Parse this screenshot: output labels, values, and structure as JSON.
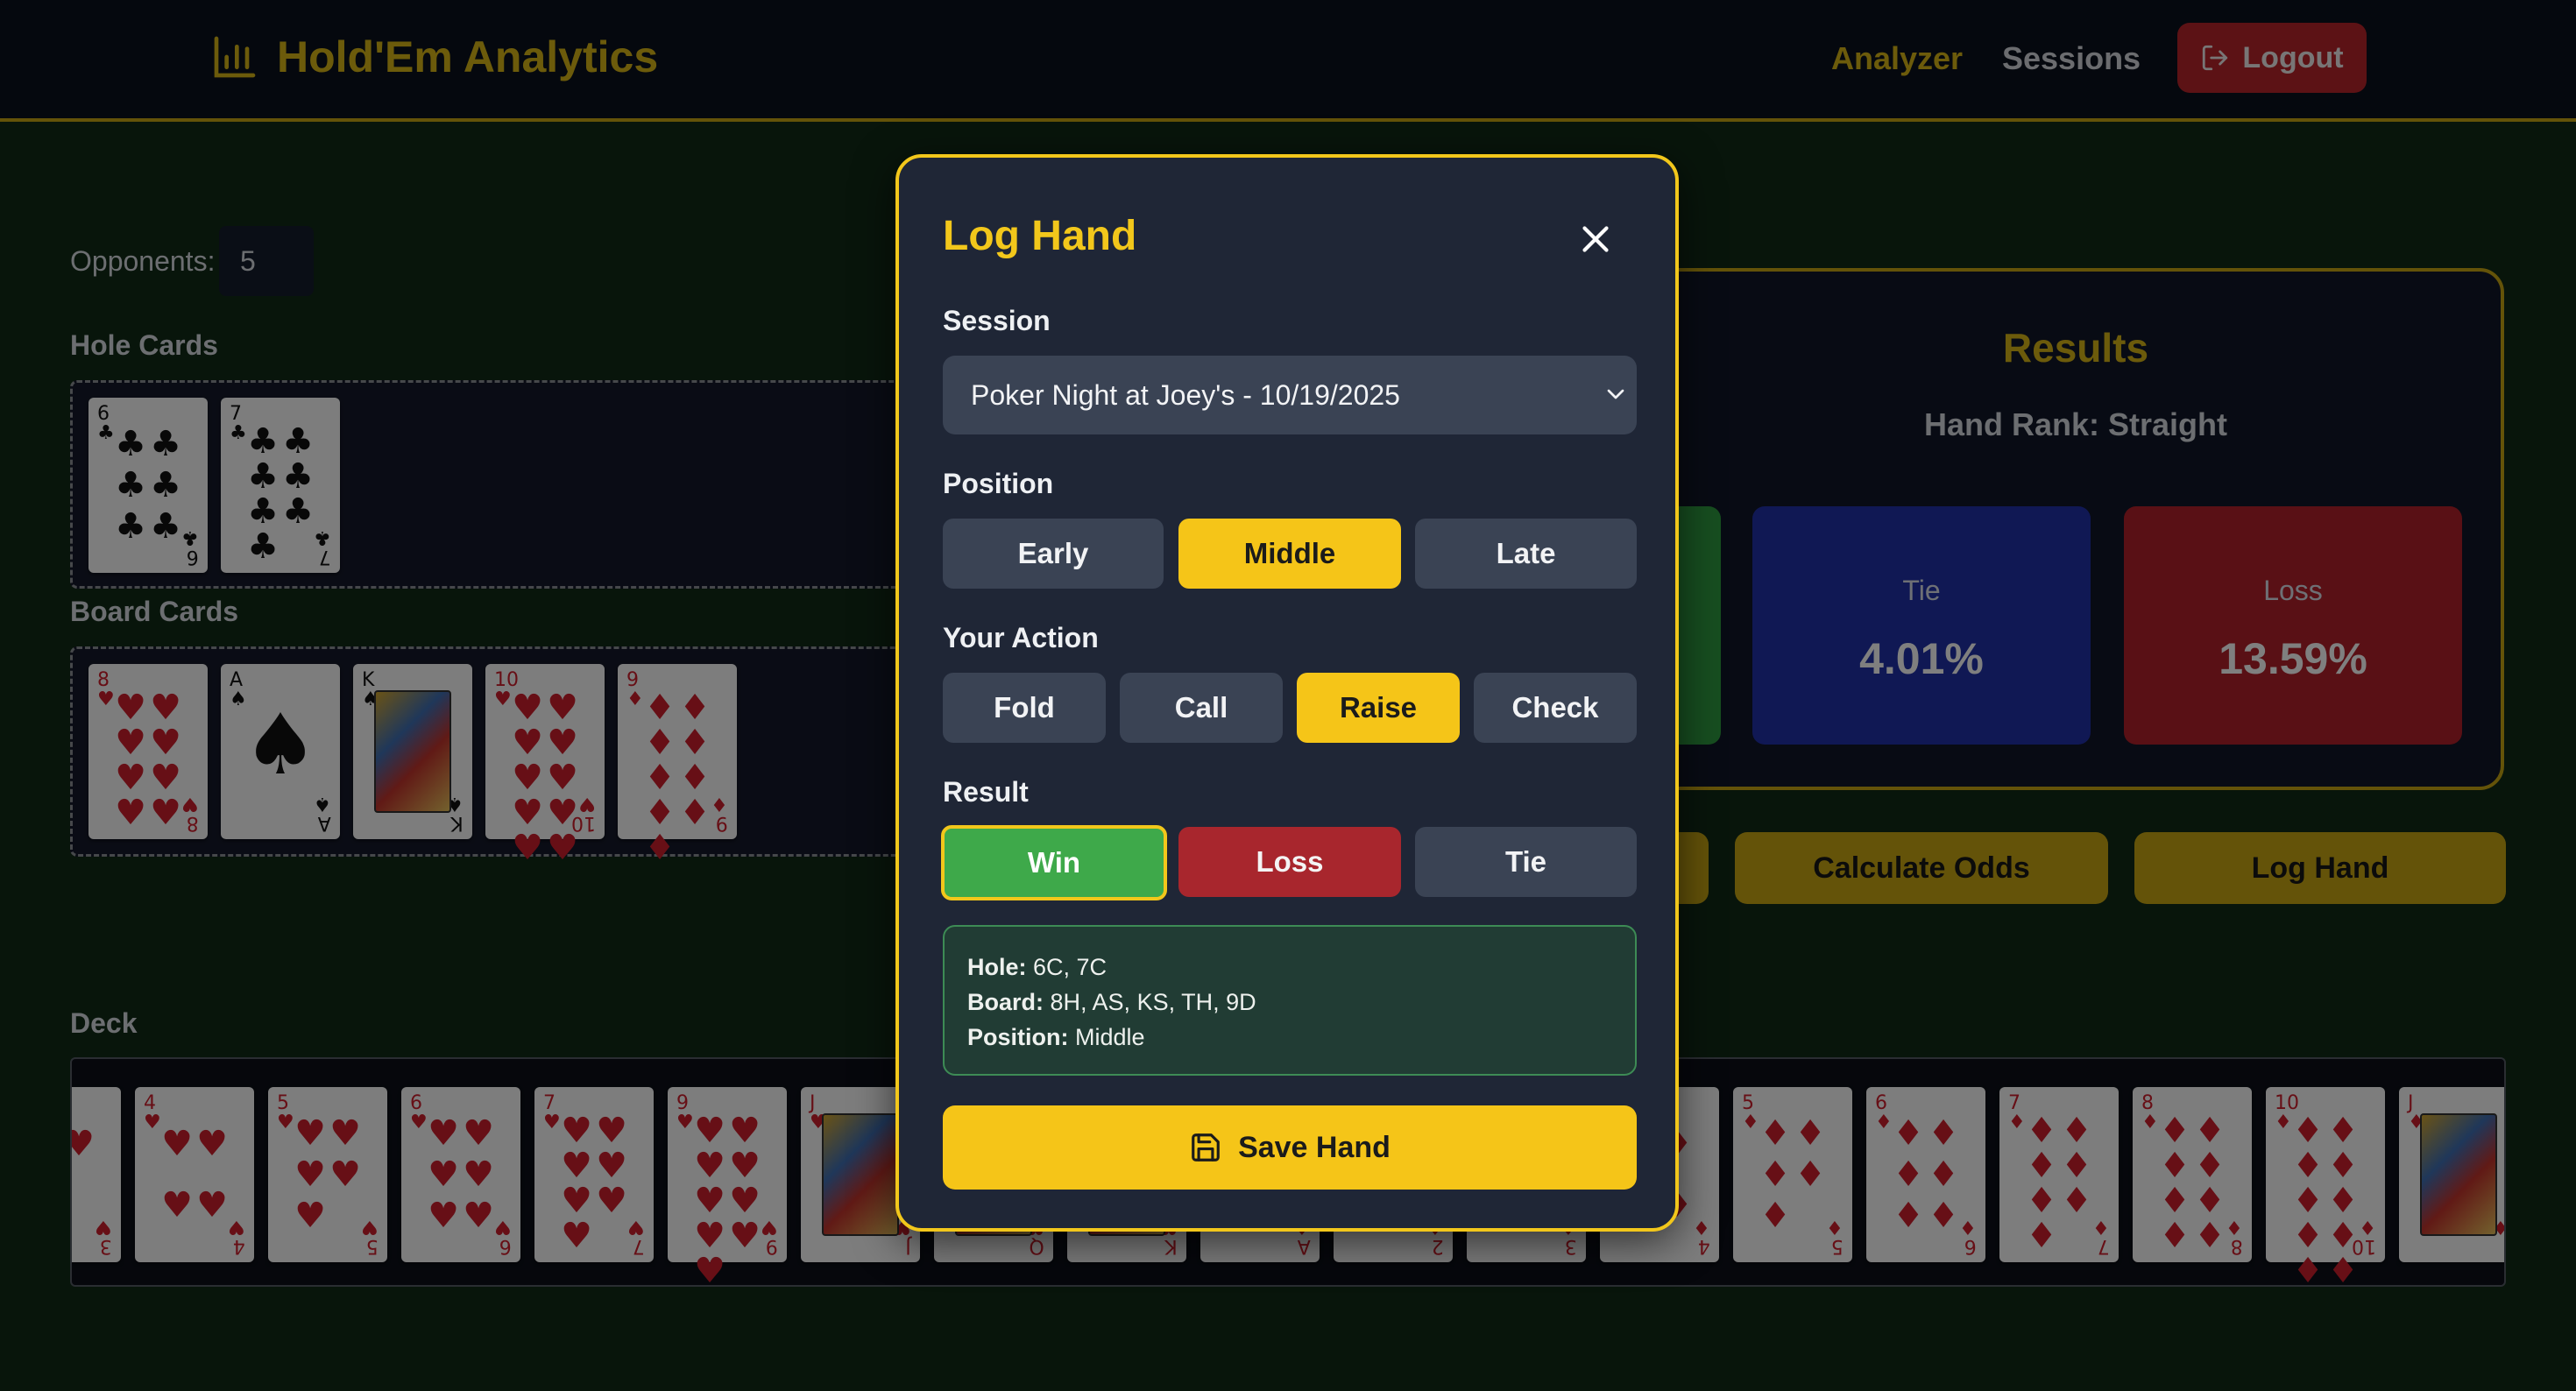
{
  "nav": {
    "brand": "Hold'Em Analytics",
    "brand_icon": "bar-chart-icon",
    "links": [
      "Analyzer",
      "Sessions"
    ],
    "logout": "Logout",
    "colors": {
      "accent": "#d8b616",
      "logout": "#b8242a"
    }
  },
  "analyzer": {
    "opponents_label": "Opponents:",
    "opponents_value": "5",
    "hole_label": "Hole Cards",
    "board_label": "Board Cards",
    "deck_label": "Deck",
    "hole_cards": [
      {
        "rank": "6",
        "suit": "♣"
      },
      {
        "rank": "7",
        "suit": "♣"
      }
    ],
    "board_cards": [
      {
        "rank": "8",
        "suit": "♥"
      },
      {
        "rank": "A",
        "suit": "♠"
      },
      {
        "rank": "K",
        "suit": "♠"
      },
      {
        "rank": "10",
        "suit": "♥"
      },
      {
        "rank": "9",
        "suit": "♦"
      }
    ],
    "deck_cards": [
      {
        "rank": "3",
        "suit": "♥"
      },
      {
        "rank": "4",
        "suit": "♥"
      },
      {
        "rank": "5",
        "suit": "♥"
      },
      {
        "rank": "6",
        "suit": "♥"
      },
      {
        "rank": "7",
        "suit": "♥"
      },
      {
        "rank": "9",
        "suit": "♥"
      },
      {
        "rank": "J",
        "suit": "♥"
      },
      {
        "rank": "Q",
        "suit": "♥"
      },
      {
        "rank": "K",
        "suit": "♥"
      },
      {
        "rank": "A",
        "suit": "♦"
      },
      {
        "rank": "2",
        "suit": "♦"
      },
      {
        "rank": "3",
        "suit": "♦"
      },
      {
        "rank": "4",
        "suit": "♦"
      },
      {
        "rank": "5",
        "suit": "♦"
      },
      {
        "rank": "6",
        "suit": "♦"
      },
      {
        "rank": "7",
        "suit": "♦"
      },
      {
        "rank": "8",
        "suit": "♦"
      },
      {
        "rank": "10",
        "suit": "♦"
      },
      {
        "rank": "J",
        "suit": "♦"
      }
    ]
  },
  "results": {
    "title": "Results",
    "hand_rank": "Hand Rank: Straight",
    "tie_label": "Tie",
    "tie_value": "4.01%",
    "loss_label": "Loss",
    "loss_value": "13.59%",
    "calculate_btn": "Calculate Odds",
    "log_btn": "Log Hand"
  },
  "modal": {
    "title": "Log Hand",
    "session_label": "Session",
    "session_value": "Poker Night at Joey's - 10/19/2025",
    "position_label": "Position",
    "positions": [
      "Early",
      "Middle",
      "Late"
    ],
    "position_selected": "Middle",
    "action_label": "Your Action",
    "actions": [
      "Fold",
      "Call",
      "Raise",
      "Check"
    ],
    "action_selected": "Raise",
    "result_label": "Result",
    "results": [
      "Win",
      "Loss",
      "Tie"
    ],
    "result_selected": "Win",
    "summary": {
      "hole_label": "Hole:",
      "hole_value": "6C, 7C",
      "board_label": "Board:",
      "board_value": "8H, AS, KS, TH, 9D",
      "position_label": "Position:",
      "position_value": "Middle"
    },
    "save": "Save Hand"
  }
}
